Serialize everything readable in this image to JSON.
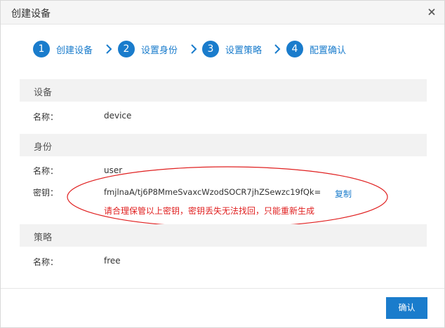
{
  "dialog": {
    "title": "创建设备"
  },
  "steps": [
    {
      "num": "1",
      "label": "创建设备"
    },
    {
      "num": "2",
      "label": "设置身份"
    },
    {
      "num": "3",
      "label": "设置策略"
    },
    {
      "num": "4",
      "label": "配置确认"
    }
  ],
  "sections": {
    "device": {
      "header": "设备",
      "name_label": "名称：",
      "name_value": "device"
    },
    "identity": {
      "header": "身份",
      "name_label": "名称：",
      "name_value": "user",
      "key_label": "密钥：",
      "key_value": "fmjlnaA/tj6P8MmeSvaxcWzodSOCR7jhZSewzc19fQk=",
      "copy_label": "复制",
      "warning": "请合理保管以上密钥，密钥丢失无法找回，只能重新生成"
    },
    "policy": {
      "header": "策略",
      "name_label": "名称：",
      "name_value": "free"
    }
  },
  "footer": {
    "confirm_label": "确认"
  },
  "colors": {
    "accent": "#1a7ccc",
    "warning": "#e02020",
    "annotation": "#e02020"
  }
}
